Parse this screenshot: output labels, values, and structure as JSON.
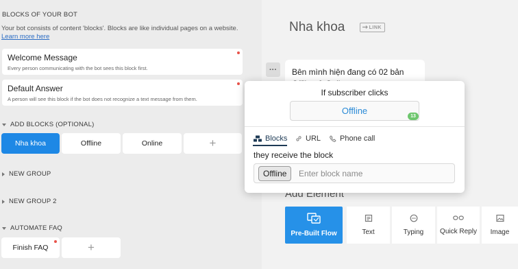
{
  "sidebar": {
    "heading": "BLOCKS OF YOUR BOT",
    "description": "Your bot consists of content 'blocks'. Blocks are like individual pages on a website.",
    "learn_more": "Learn more here",
    "system_blocks": [
      {
        "title": "Welcome Message",
        "subtitle": "Every person communicating with the bot sees this block first."
      },
      {
        "title": "Default Answer",
        "subtitle": "A person will see this block if the bot does not recognize a text message from them."
      }
    ],
    "groups": [
      {
        "label": "ADD BLOCKS (OPTIONAL)",
        "blocks": [
          "Nha khoa",
          "Offline",
          "Online"
        ]
      },
      {
        "label": "NEW GROUP"
      },
      {
        "label": "NEW GROUP 2"
      },
      {
        "label": "AUTOMATE FAQ",
        "blocks": [
          "Finish FAQ"
        ]
      }
    ]
  },
  "main": {
    "block_title": "Nha khoa",
    "link_badge": "LINK",
    "text_message": "Bên mình hiện đang có 02 bản Offline & Online",
    "add_element": "Add Element",
    "tools": [
      "Pre-Built Flow",
      "Text",
      "Typing",
      "Quick Reply",
      "Image"
    ]
  },
  "popup": {
    "title": "If subscriber clicks",
    "button_value": "Offline",
    "count": "13",
    "tabs": [
      "Blocks",
      "URL",
      "Phone call"
    ],
    "receive_label": "they receive the block",
    "selected_chip": "Offline",
    "input_placeholder": "Enter block name"
  },
  "colors": {
    "accent": "#1e88e5",
    "alert_dot": "#e8534a",
    "count_badge": "#6dc66d"
  }
}
